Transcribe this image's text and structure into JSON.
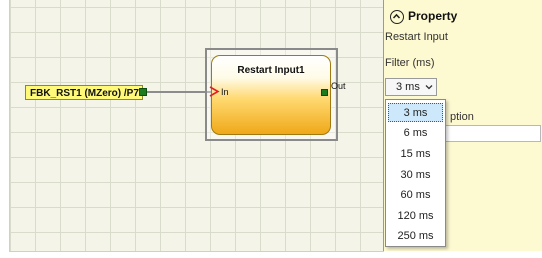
{
  "canvas": {
    "input_tag": "FBK_RST1 (MZero) /P7",
    "block": {
      "title": "Restart Input1",
      "in_label": "In",
      "out_label": "Out"
    }
  },
  "panel": {
    "title": "Property",
    "subtitle": "Restart Input",
    "filter_label": "Filter (ms)",
    "filter_value": "3 ms",
    "description_label_visible": "ption",
    "filter_options": [
      "3 ms",
      "6 ms",
      "15 ms",
      "30 ms",
      "60 ms",
      "120 ms",
      "250 ms"
    ]
  },
  "colors": {
    "panel_bg": "#fdf9d1",
    "block_fill": "#f0a818",
    "tag_fill": "#fff97a",
    "port": "#1e7a1e"
  },
  "icons": {
    "collapse": "chevron-up-circle-icon",
    "combo": "chevron-down-icon",
    "input_arrow": "input-arrow-icon"
  }
}
